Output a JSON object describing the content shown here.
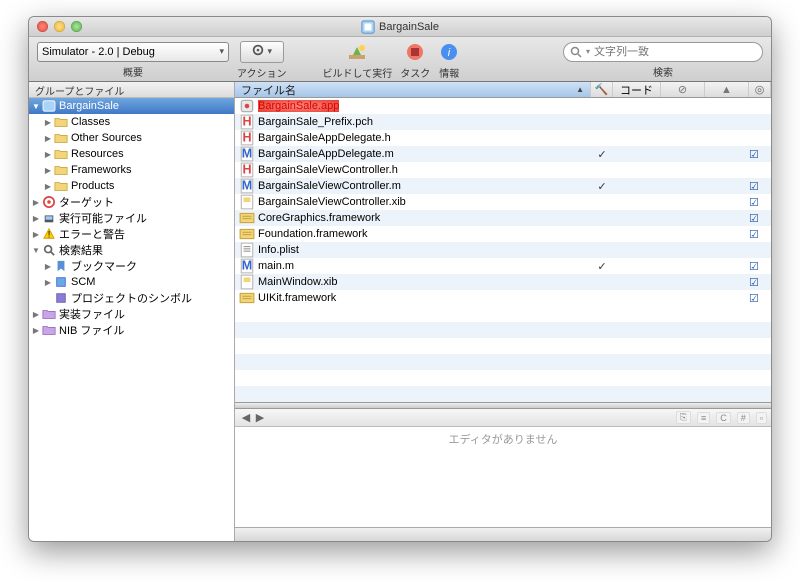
{
  "window": {
    "title": "BargainSale"
  },
  "toolbar": {
    "selector": "Simulator - 2.0 | Debug",
    "overview_label": "概要",
    "action_label": "アクション",
    "build_run_label": "ビルドして実行",
    "task_label": "タスク",
    "info_label": "情報",
    "search_placeholder": "文字列一致",
    "search_label": "検索"
  },
  "sidebar": {
    "header": "グループとファイル",
    "project": "BargainSale",
    "folders": [
      "Classes",
      "Other Sources",
      "Resources",
      "Frameworks",
      "Products"
    ],
    "items": [
      "ターゲット",
      "実行可能ファイル",
      "エラーと警告",
      "検索結果",
      "ブックマーク",
      "SCM",
      "プロジェクトのシンボル",
      "実装ファイル",
      "NIB ファイル"
    ]
  },
  "list": {
    "col_name": "ファイル名",
    "col_code": "コード",
    "files": [
      {
        "icon": "app",
        "name": "BargainSale.app",
        "red": true
      },
      {
        "icon": "h",
        "name": "BargainSale_Prefix.pch"
      },
      {
        "icon": "h",
        "name": "BargainSaleAppDelegate.h"
      },
      {
        "icon": "m",
        "name": "BargainSaleAppDelegate.m",
        "check": true,
        "box": true
      },
      {
        "icon": "h",
        "name": "BargainSaleViewController.h"
      },
      {
        "icon": "m",
        "name": "BargainSaleViewController.m",
        "check": true,
        "box": true
      },
      {
        "icon": "xib",
        "name": "BargainSaleViewController.xib",
        "box": true
      },
      {
        "icon": "fw",
        "name": "CoreGraphics.framework",
        "box": true
      },
      {
        "icon": "fw",
        "name": "Foundation.framework",
        "box": true
      },
      {
        "icon": "txt",
        "name": "Info.plist"
      },
      {
        "icon": "m",
        "name": "main.m",
        "check": true,
        "box": true
      },
      {
        "icon": "xib",
        "name": "MainWindow.xib",
        "box": true
      },
      {
        "icon": "fw",
        "name": "UIKit.framework",
        "box": true
      }
    ]
  },
  "editor": {
    "empty_message": "エディタがありません"
  }
}
